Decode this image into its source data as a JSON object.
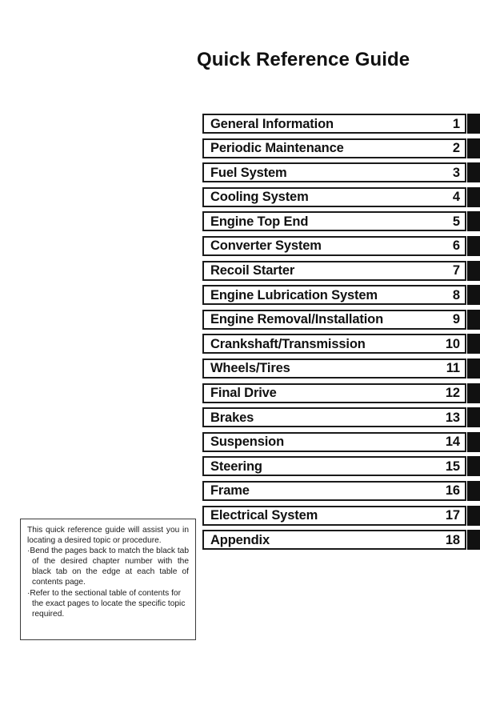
{
  "document": {
    "title": "Quick Reference Guide"
  },
  "chapters": [
    {
      "number": "1",
      "label": "General Information"
    },
    {
      "number": "2",
      "label": "Periodic Maintenance"
    },
    {
      "number": "3",
      "label": "Fuel System"
    },
    {
      "number": "4",
      "label": "Cooling System"
    },
    {
      "number": "5",
      "label": "Engine Top End"
    },
    {
      "number": "6",
      "label": "Converter System"
    },
    {
      "number": "7",
      "label": "Recoil Starter"
    },
    {
      "number": "8",
      "label": "Engine Lubrication System"
    },
    {
      "number": "9",
      "label": "Engine Removal/Installation"
    },
    {
      "number": "10",
      "label": "Crankshaft/Transmission"
    },
    {
      "number": "11",
      "label": "Wheels/Tires"
    },
    {
      "number": "12",
      "label": "Final Drive"
    },
    {
      "number": "13",
      "label": "Brakes"
    },
    {
      "number": "14",
      "label": "Suspension"
    },
    {
      "number": "15",
      "label": "Steering"
    },
    {
      "number": "16",
      "label": "Frame"
    },
    {
      "number": "17",
      "label": "Electrical System"
    },
    {
      "number": "18",
      "label": "Appendix"
    }
  ],
  "note": {
    "intro": "This quick reference guide will assist you in locating a desired topic or procedure.",
    "bullets": [
      "Bend the pages back to match the black tab of the desired chapter number with the black tab on the edge at each table of contents page.",
      "Refer to the sectional table of contents for the exact pages to locate the specific topic required."
    ],
    "bullet_glyph": "·"
  },
  "colors": {
    "ink": "#111111",
    "tab": "#111111",
    "paper": "#ffffff",
    "note_border": "#3b3b3b"
  }
}
